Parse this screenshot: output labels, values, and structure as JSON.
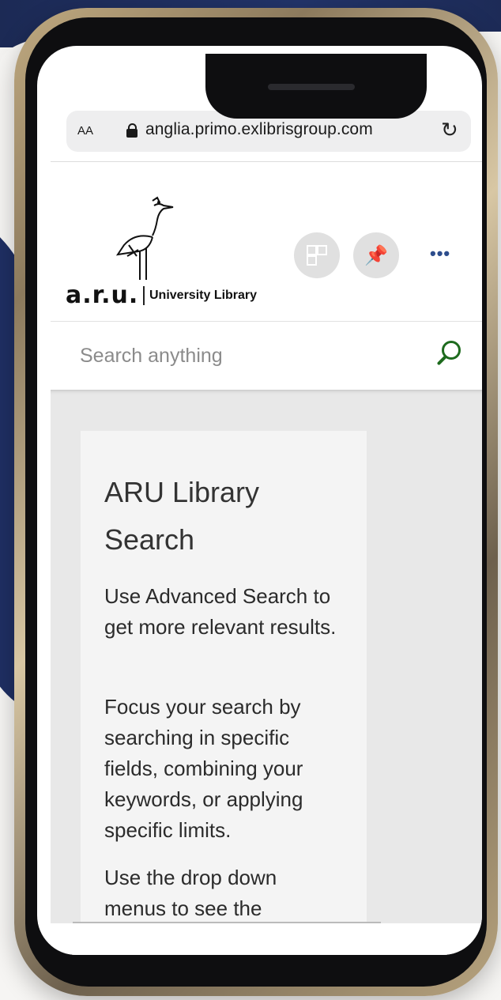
{
  "browser": {
    "text_size_label": "AA",
    "url": "anglia.primo.exlibrisgroup.com",
    "reload_icon": "reload-icon"
  },
  "header": {
    "logo_text": "a.r.u.",
    "logo_subtitle": "University Library",
    "actions": [
      "qr-code-icon",
      "pin-icon",
      "more-icon"
    ],
    "more_label": "•••"
  },
  "search": {
    "placeholder": "Search anything",
    "icon": "search-icon",
    "icon_color": "#1e6b1e"
  },
  "card": {
    "title": "ARU Library Search",
    "paragraphs": [
      "Use Advanced Search to get more relevant results.",
      "Focus your search by searching in specific fields, combining your keywords, or applying specific limits.",
      "Use the drop down menus to see the"
    ]
  },
  "colors": {
    "accent_green": "#1e6b1e",
    "more_blue": "#2d4d8c"
  }
}
